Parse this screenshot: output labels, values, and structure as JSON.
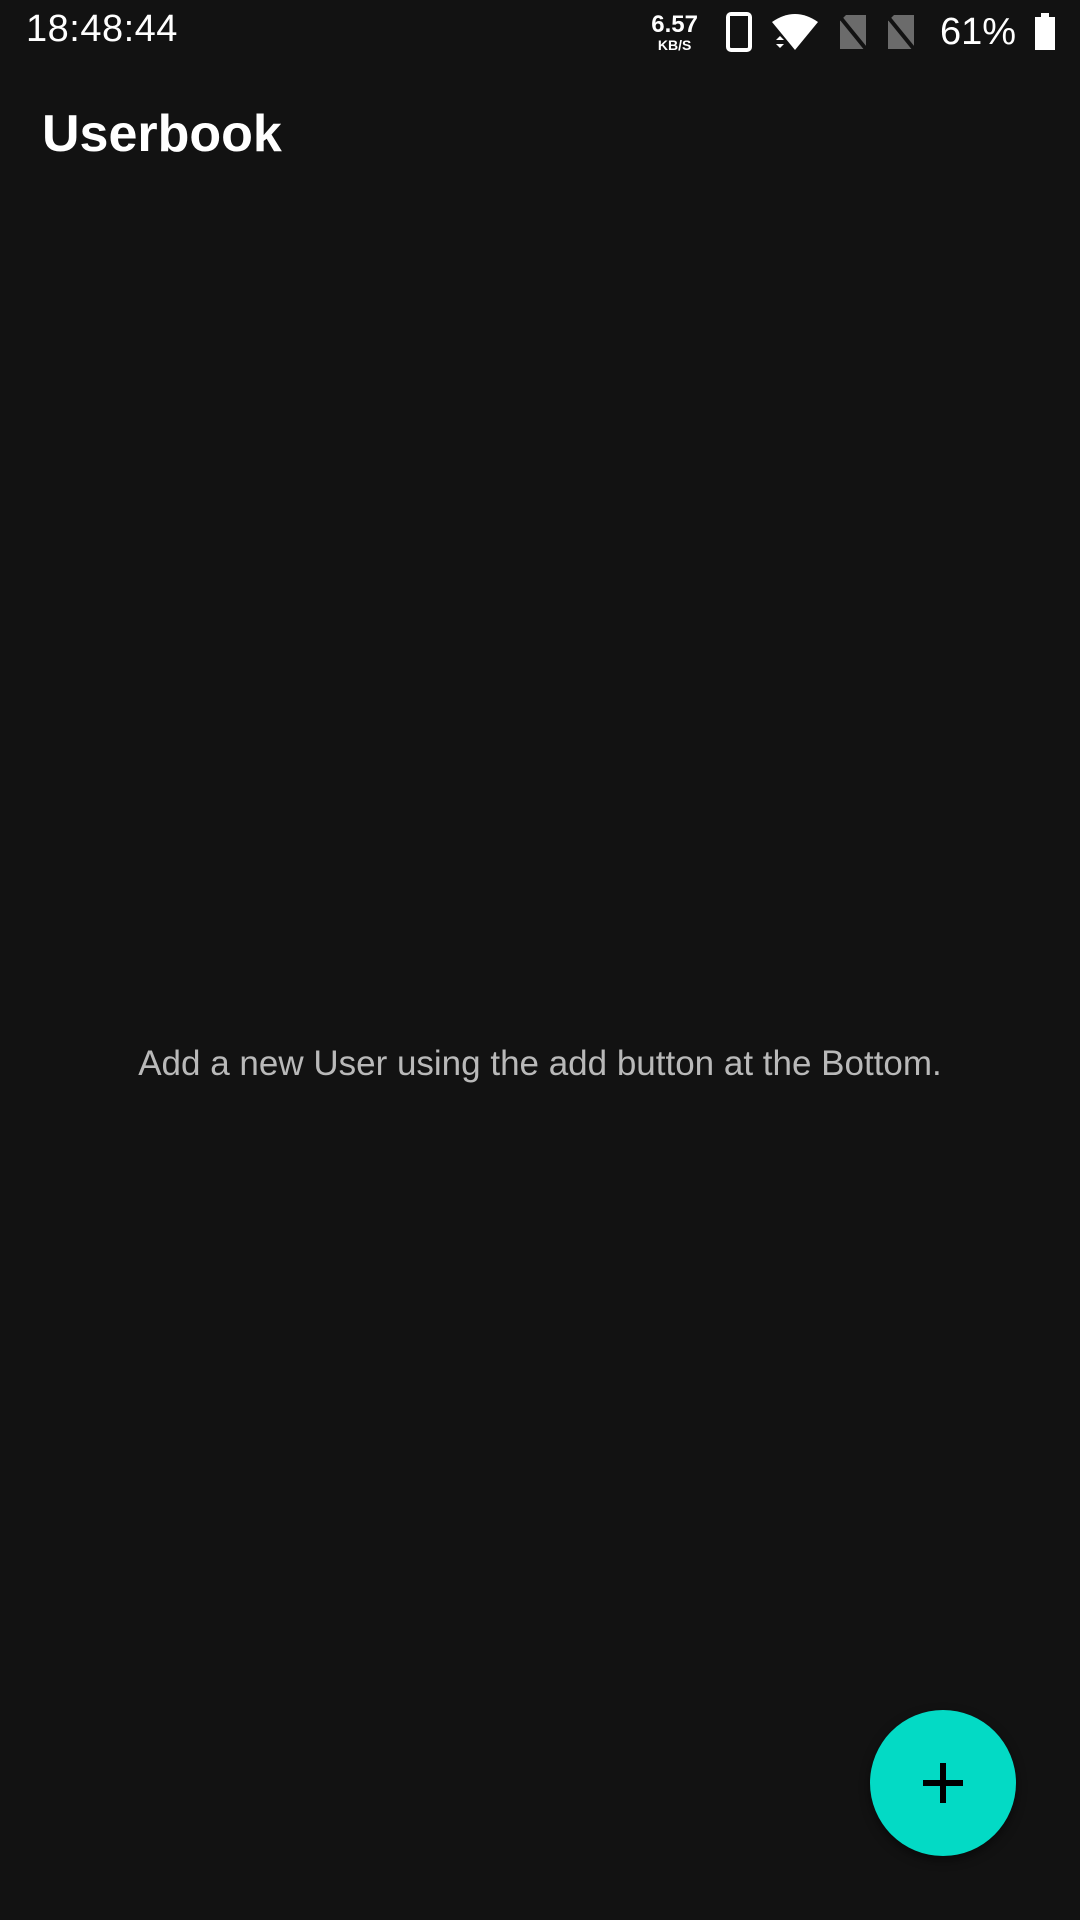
{
  "status_bar": {
    "time": "18:48:44",
    "net_speed_value": "6.57",
    "net_speed_unit": "KB/S",
    "battery_percent": "61%",
    "battery_level": 0.61,
    "icons": [
      "phone-icon",
      "wifi-icon",
      "no-sim-icon",
      "no-sim-icon",
      "battery-icon"
    ]
  },
  "app_bar": {
    "title": "Userbook"
  },
  "main": {
    "empty_message": "Add a new User using the add button at the Bottom."
  },
  "fab": {
    "icon": "plus-icon",
    "color": "#03dac5"
  },
  "colors": {
    "background": "#121212",
    "accent": "#03dac5",
    "secondary_text": "#b9b9b9"
  }
}
